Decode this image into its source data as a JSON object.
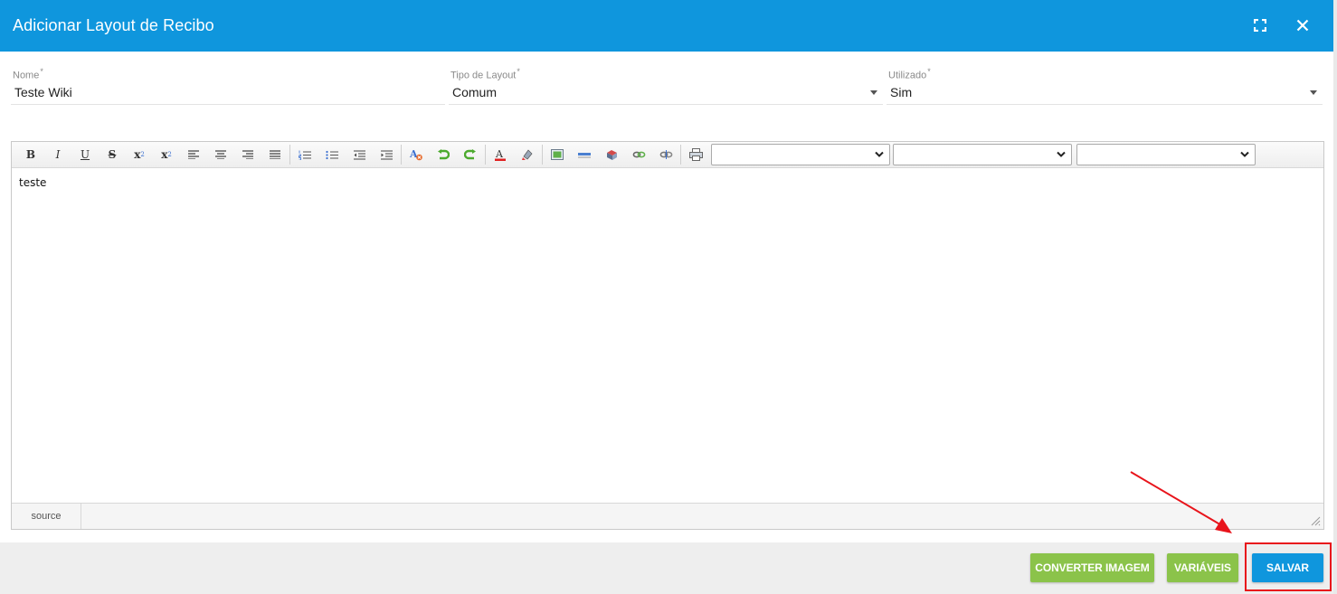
{
  "dialog": {
    "title": "Adicionar Layout de Recibo"
  },
  "form": {
    "nome": {
      "label": "Nome",
      "required_mark": "*",
      "value": "Teste Wiki"
    },
    "tipo_layout": {
      "label": "Tipo de Layout",
      "required_mark": "*",
      "value": "Comum"
    },
    "utilizado": {
      "label": "Utilizado",
      "required_mark": "*",
      "value": "Sim"
    }
  },
  "editor": {
    "content": "teste",
    "source_tab": "source",
    "toolbar": {
      "bold": "B",
      "italic": "I",
      "underline": "U",
      "strike": "S",
      "subscript": "x",
      "superscript": "x"
    }
  },
  "footer": {
    "convert_label": "CONVERTER IMAGEM",
    "variables_label": "VARIÁVEIS",
    "save_label": "SALVAR"
  },
  "colors": {
    "header": "#0f96dd",
    "green_button": "#8bc34a",
    "save_button": "#0f96dd",
    "annotation": "#e8141b"
  }
}
